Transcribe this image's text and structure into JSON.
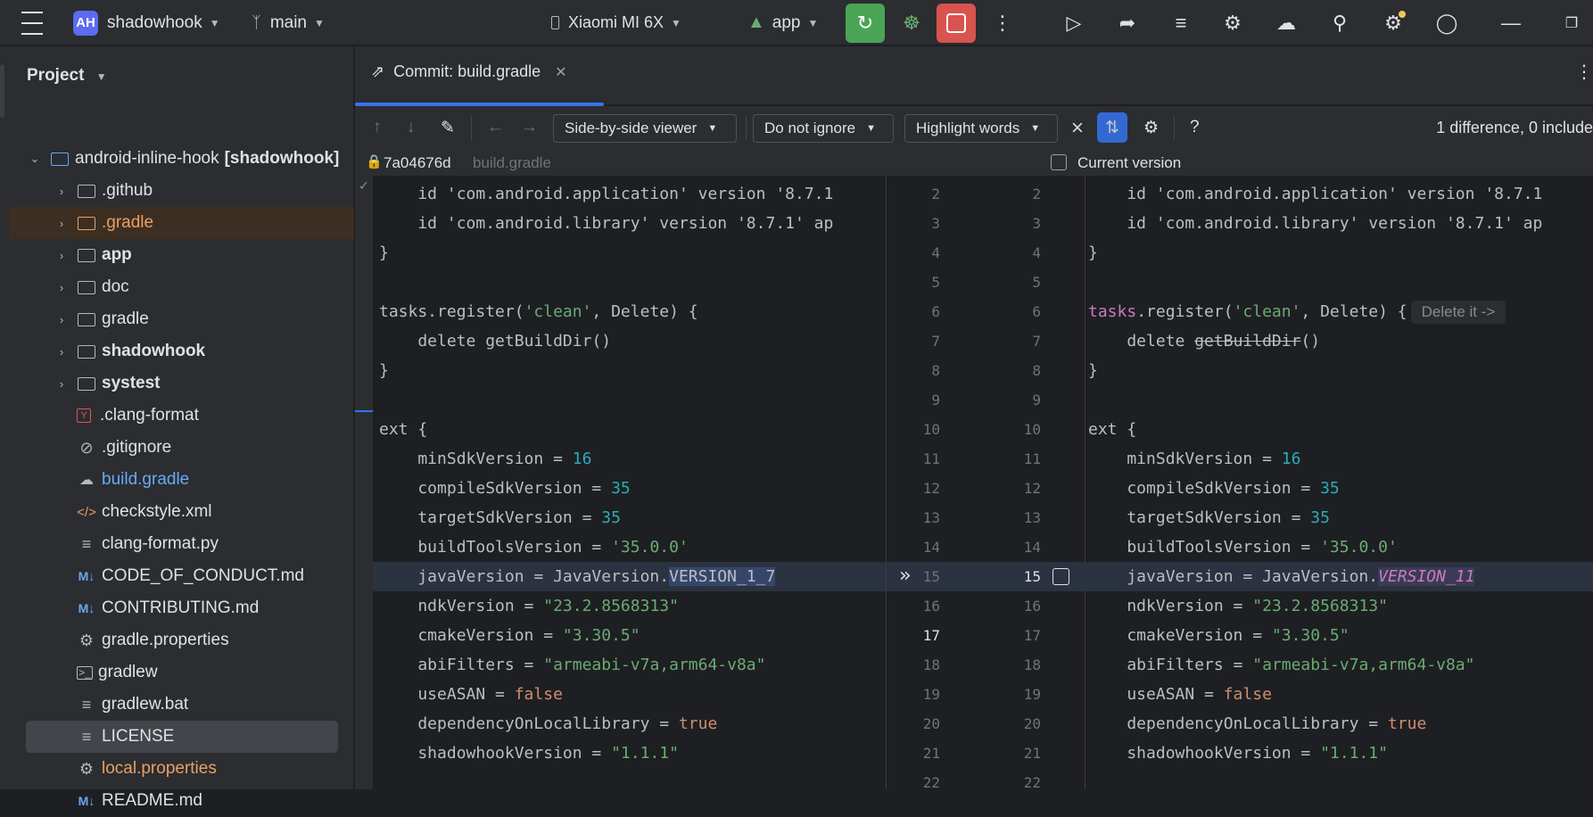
{
  "topbar": {
    "project_initials": "AH",
    "project_name": "shadowhook",
    "branch": "main",
    "device": "Xiaomi MI 6X",
    "run_config": "app"
  },
  "sidebar": {
    "title": "Project",
    "root": {
      "name": "android-inline-hook",
      "module": "[shadowhook]"
    },
    "items": [
      {
        "label": ".github"
      },
      {
        "label": ".gradle"
      },
      {
        "label": "app"
      },
      {
        "label": "doc"
      },
      {
        "label": "gradle"
      },
      {
        "label": "shadowhook"
      },
      {
        "label": "systest"
      },
      {
        "label": ".clang-format"
      },
      {
        "label": ".gitignore"
      },
      {
        "label": "build.gradle"
      },
      {
        "label": "checkstyle.xml"
      },
      {
        "label": "clang-format.py"
      },
      {
        "label": "CODE_OF_CONDUCT.md"
      },
      {
        "label": "CONTRIBUTING.md"
      },
      {
        "label": "gradle.properties"
      },
      {
        "label": "gradlew"
      },
      {
        "label": "gradlew.bat"
      },
      {
        "label": "LICENSE"
      },
      {
        "label": "local.properties"
      },
      {
        "label": "README.md"
      }
    ]
  },
  "tab": {
    "label": "Commit: build.gradle"
  },
  "diff_toolbar": {
    "viewer": "Side-by-side viewer",
    "ignore": "Do not ignore",
    "highlight": "Highlight words",
    "summary": "1 difference, 0 include"
  },
  "pathbar": {
    "revision": "7a04676d",
    "file": "build.gradle",
    "current_version": "Current version"
  },
  "hint": {
    "label": "Delete it ->"
  },
  "diff_lines": {
    "l2": "    id 'com.android.application' version '8.7.1",
    "l3": "    id 'com.android.library' version '8.7.1' ap",
    "l4": "}",
    "l6a": "tasks.register(",
    "l6b": "'clean'",
    "l6c": ", Delete) {",
    "l7a": "    delete ",
    "l7b": "getBuildDir",
    "l7c": "()",
    "l8": "}",
    "l10": "ext {",
    "min": "    minSdkVersion = ",
    "min_v": "16",
    "compile": "    compileSdkVersion = ",
    "compile_v": "35",
    "target": "    targetSdkVersion = ",
    "target_v": "35",
    "build": "    buildToolsVersion = ",
    "build_v": "'35.0.0'",
    "java": "    javaVersion = JavaVersion.",
    "java_old": "VERSION_1_7",
    "java_new": "VERSION_11",
    "ndk": "    ndkVersion = ",
    "ndk_v": "\"23.2.8568313\"",
    "cmake": "    cmakeVersion = ",
    "cmake_v": "\"3.30.5\"",
    "abi": "    abiFilters = ",
    "abi_v": "\"armeabi-v7a,arm64-v8a\"",
    "asan": "    useASAN = ",
    "asan_v": "false",
    "dep": "    dependencyOnLocalLibrary = ",
    "dep_v": "true",
    "sh": "    shadowhookVersion = ",
    "sh_v": "\"1.1.1\""
  },
  "line_numbers": {
    "left": [
      "2",
      "3",
      "4",
      "5",
      "6",
      "7",
      "8",
      "9",
      "10",
      "11",
      "12",
      "13",
      "14",
      "15",
      "16",
      "17",
      "18",
      "19",
      "20",
      "21",
      "22"
    ],
    "right": [
      "2",
      "3",
      "4",
      "5",
      "6",
      "7",
      "8",
      "9",
      "10",
      "11",
      "12",
      "13",
      "14",
      "15",
      "16",
      "17",
      "18",
      "19",
      "20",
      "21",
      "22"
    ]
  }
}
